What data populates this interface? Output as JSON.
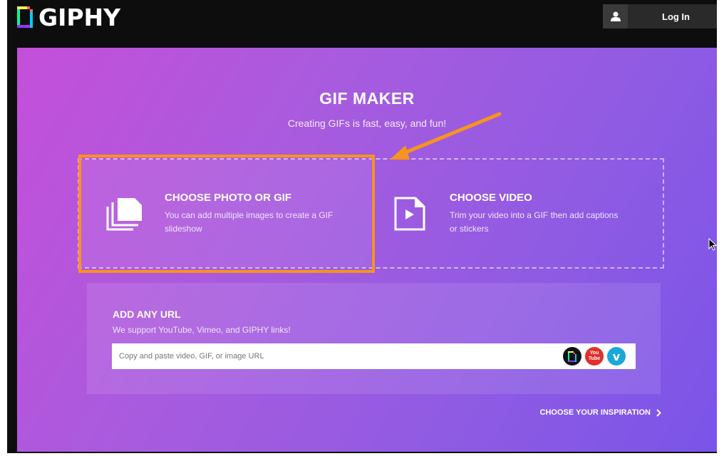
{
  "brand": {
    "name": "GIPHY"
  },
  "header": {
    "login_label": "Log In"
  },
  "hero": {
    "title": "GIF MAKER",
    "subtitle": "Creating GIFs is fast, easy, and fun!"
  },
  "choose_photo": {
    "title": "CHOOSE PHOTO OR GIF",
    "description": "You can add multiple images to create a GIF slideshow"
  },
  "choose_video": {
    "title": "CHOOSE VIDEO",
    "description": "Trim your video into a GIF then add captions or stickers"
  },
  "url_section": {
    "title": "ADD ANY URL",
    "subtitle": "We support YouTube, Vimeo, and GIPHY links!",
    "placeholder": "Copy and paste video, GIF, or image URL",
    "services": [
      "giphy-icon",
      "youtube-icon",
      "vimeo-icon"
    ],
    "youtube_text": "You Tube",
    "vimeo_text": "v"
  },
  "footer": {
    "inspiration_label": "CHOOSE YOUR INSPIRATION"
  },
  "colors": {
    "highlight": "#f7941d",
    "background_start": "#c44fd9",
    "background_end": "#7a54e8"
  }
}
